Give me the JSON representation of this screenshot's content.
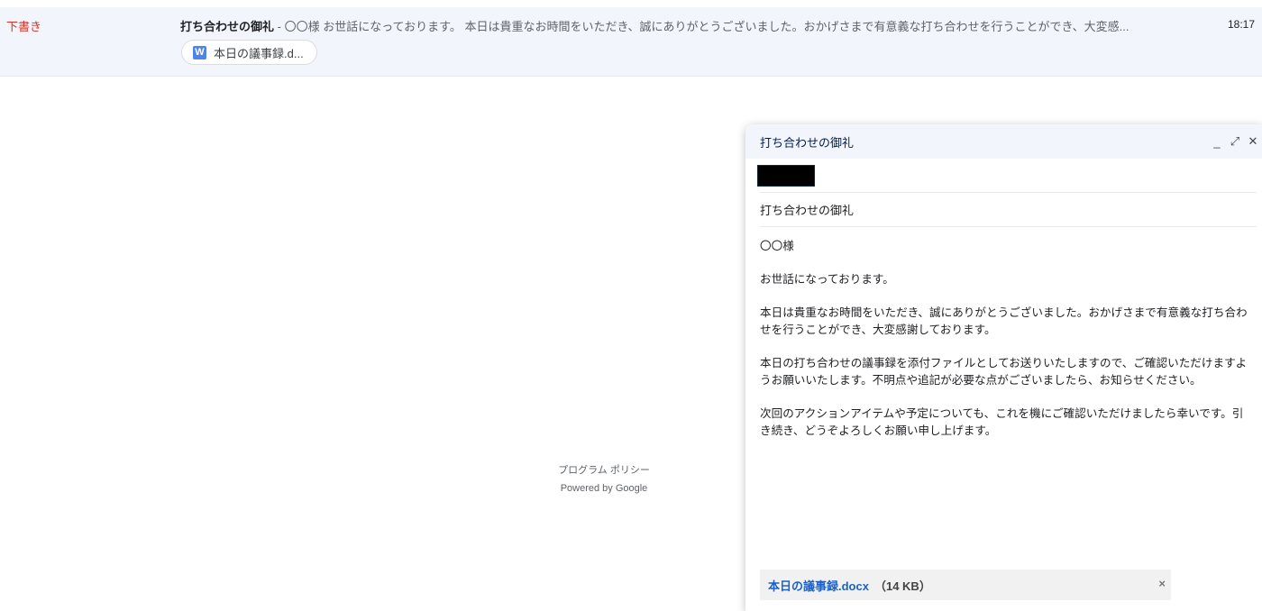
{
  "email_row": {
    "label": "下書き",
    "subject": "打ち合わせの御礼",
    "separator": " - ",
    "snippet": "〇〇様 お世話になっております。 本日は貴重なお時間をいただき、誠にありがとうございました。おかげさまで有意義な打ち合わせを行うことができ、大変感...",
    "time": "18:17",
    "attachment_chip": {
      "icon": "word-doc-icon",
      "icon_letter": "W",
      "label": "本日の議事録.d..."
    }
  },
  "footer": {
    "policy": "プログラム ポリシー",
    "powered": "Powered by Google"
  },
  "compose": {
    "title": "打ち合わせの御礼",
    "controls": {
      "minimize": "_",
      "expand": "⤢",
      "close": "✕"
    },
    "subject": "打ち合わせの御礼",
    "body": [
      "〇〇様",
      "お世話になっております。",
      "本日は貴重なお時間をいただき、誠にありがとうございました。おかげさまで有意義な打ち合わせを行うことができ、大変感謝しております。",
      "本日の打ち合わせの議事録を添付ファイルとしてお送りいたしますので、ご確認いただけますようお願いいたします。不明点や追記が必要な点がございましたら、お知らせください。",
      "次回のアクションアイテムや予定についても、これを機にご確認いただけましたら幸いです。引き続き、どうぞよろしくお願い申し上げます。"
    ],
    "attachment": {
      "name": "本日の議事録.docx",
      "size": "（14 KB）",
      "remove": "×"
    }
  }
}
